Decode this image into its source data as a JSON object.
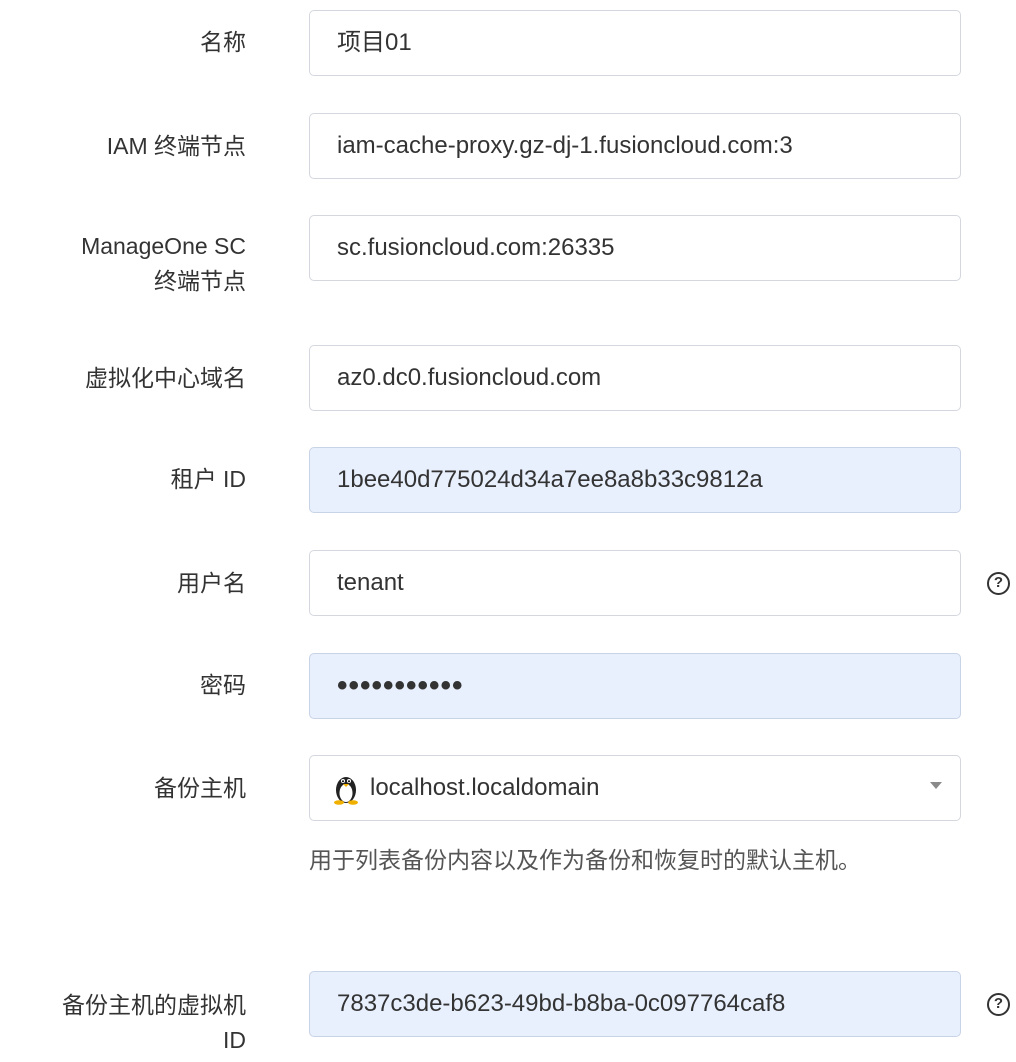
{
  "form": {
    "name": {
      "label": "名称",
      "value": "项目01"
    },
    "iam": {
      "label": "IAM 终端节点",
      "value": "iam-cache-proxy.gz-dj-1.fusioncloud.com:3"
    },
    "sc": {
      "label_line1": "ManageOne SC",
      "label_line2": "终端节点",
      "value": "sc.fusioncloud.com:26335"
    },
    "domain": {
      "label": "虚拟化中心域名",
      "value": "az0.dc0.fusioncloud.com"
    },
    "tenant_id": {
      "label": "租户 ID",
      "value": "1bee40d775024d34a7ee8a8b33c9812a"
    },
    "username": {
      "label": "用户名",
      "value": "tenant",
      "help": "?"
    },
    "password": {
      "label": "密码",
      "value": "•••••••••••"
    },
    "backup_host": {
      "label": "备份主机",
      "selected": "localhost.localdomain",
      "icon": "linux-penguin-icon",
      "hint": "用于列表备份内容以及作为备份和恢复时的默认主机。"
    },
    "vm_id": {
      "label_line1": "备份主机的虚拟机",
      "label_line2": "ID",
      "value": "7837c3de-b623-49bd-b8ba-0c097764caf8",
      "help": "?"
    }
  },
  "colors": {
    "filled_bg": "#e8f0fe",
    "border": "#d4d8de",
    "text": "#333333"
  }
}
